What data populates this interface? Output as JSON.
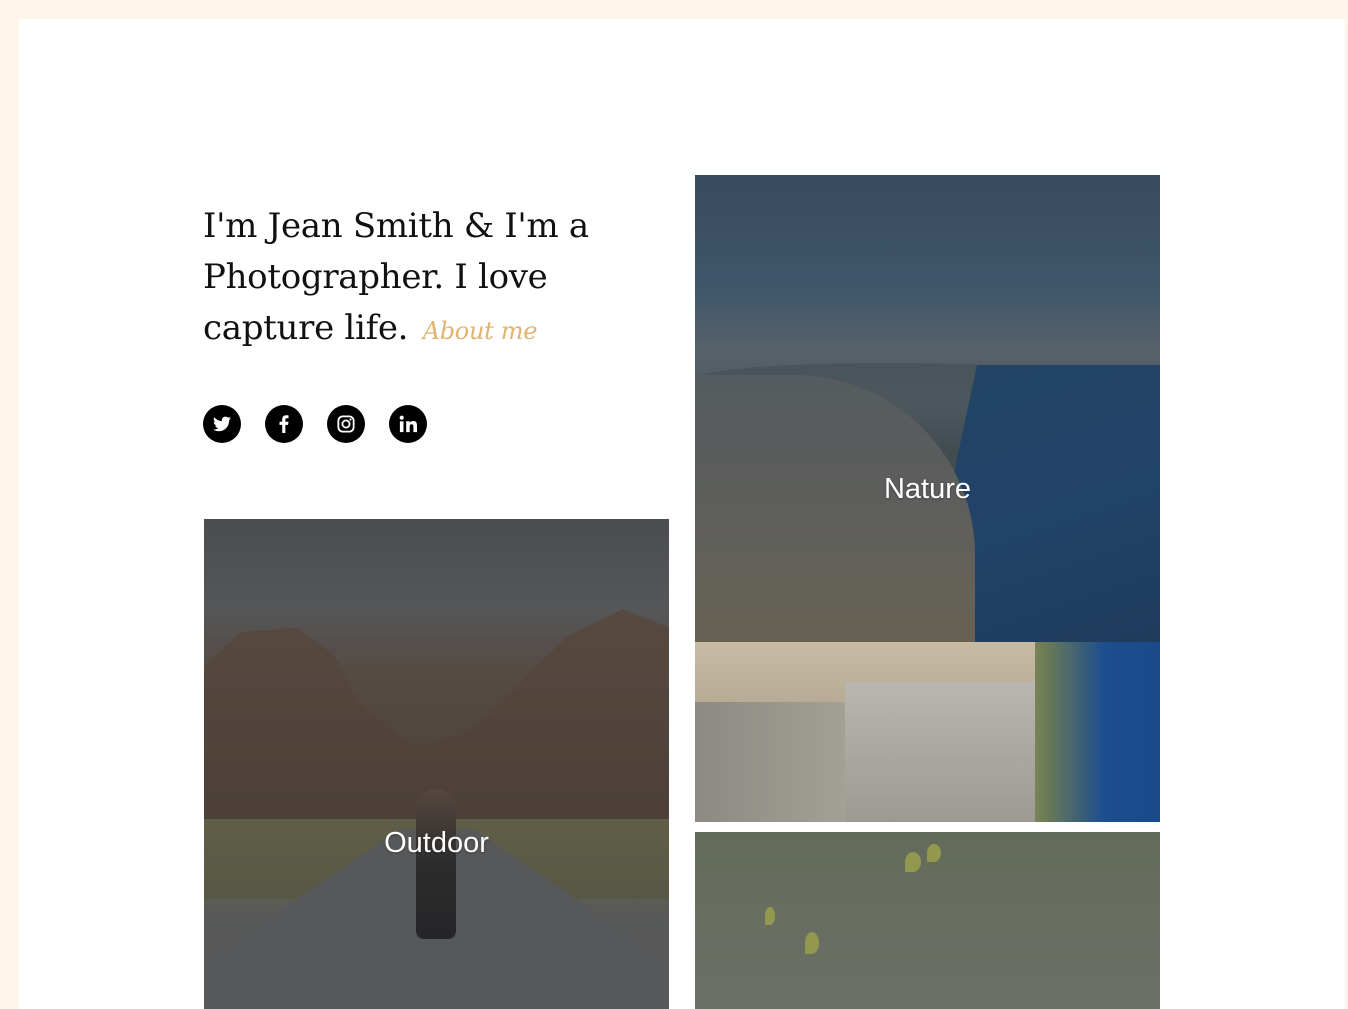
{
  "intro": {
    "line1": "I'm Jean Smith & I'm a",
    "line2": "Photographer. I love",
    "line3": "capture life.",
    "about_link": "About me"
  },
  "social": [
    {
      "name": "twitter",
      "icon": "twitter-icon"
    },
    {
      "name": "facebook",
      "icon": "facebook-icon"
    },
    {
      "name": "instagram",
      "icon": "instagram-icon"
    },
    {
      "name": "linkedin",
      "icon": "linkedin-icon"
    }
  ],
  "gallery": {
    "nature": {
      "caption": "Nature"
    },
    "outdoor": {
      "caption": "Outdoor"
    }
  },
  "colors": {
    "page_border": "#fdf5ea",
    "accent": "#e0b46f",
    "text": "#111111"
  }
}
